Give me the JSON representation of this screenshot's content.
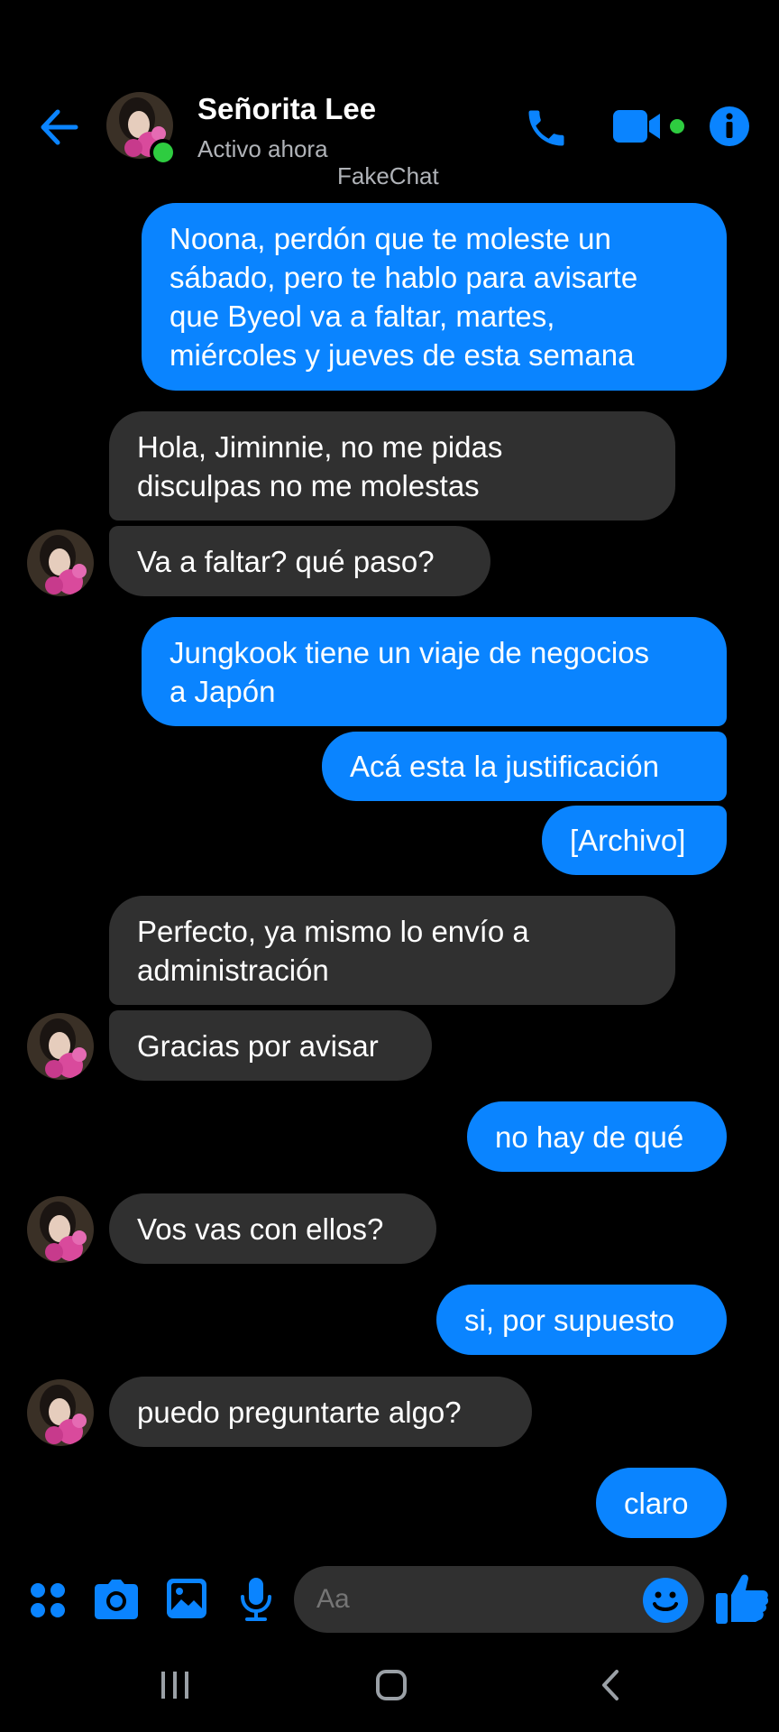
{
  "header": {
    "contact_name": "Señorita Lee",
    "status": "Activo ahora",
    "watermark": "FakeChat",
    "icons": [
      "back-arrow-icon",
      "phone-icon",
      "video-camera-icon",
      "info-icon"
    ]
  },
  "messages": [
    {
      "dir": "out",
      "lines": [
        "Noona, perdón que te moleste un",
        "sábado, pero te hablo para avisarte",
        "que Byeol va a faltar, martes,",
        "miércoles y jueves de esta semana"
      ]
    },
    {
      "dir": "in",
      "lines": [
        "Hola, Jiminnie, no me pidas",
        "disculpas no me molestas"
      ]
    },
    {
      "dir": "in",
      "lines": [
        "Va a faltar? qué paso?"
      ]
    },
    {
      "dir": "out",
      "lines": [
        "Jungkook tiene un viaje de negocios",
        "a Japón"
      ]
    },
    {
      "dir": "out",
      "lines": [
        "Acá esta la justificación"
      ]
    },
    {
      "dir": "out",
      "lines": [
        "[Archivo]"
      ]
    },
    {
      "dir": "in",
      "lines": [
        "Perfecto, ya mismo lo envío a",
        "administración"
      ]
    },
    {
      "dir": "in",
      "lines": [
        "Gracias por avisar"
      ]
    },
    {
      "dir": "out",
      "lines": [
        "no hay de qué"
      ]
    },
    {
      "dir": "in",
      "lines": [
        "Vos vas con ellos?"
      ]
    },
    {
      "dir": "out",
      "lines": [
        "si, por supuesto"
      ]
    },
    {
      "dir": "in",
      "lines": [
        "puedo preguntarte algo?"
      ]
    },
    {
      "dir": "out",
      "lines": [
        "claro"
      ]
    }
  ],
  "composer": {
    "placeholder": "Aa",
    "icons": [
      "apps-icon",
      "camera-icon",
      "gallery-icon",
      "microphone-icon",
      "emoji-icon",
      "thumbs-up-icon"
    ]
  },
  "system_nav": [
    "recent-apps-icon",
    "home-icon",
    "back-icon"
  ],
  "colors": {
    "accent": "#0a84ff",
    "incoming_bubble": "#303030",
    "background": "#000000",
    "online": "#2ecc40"
  }
}
